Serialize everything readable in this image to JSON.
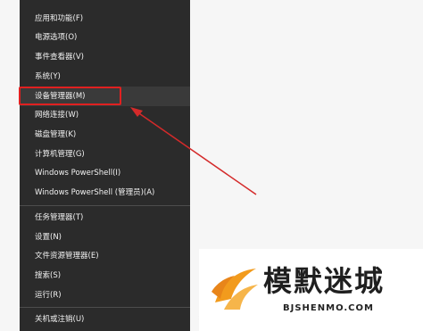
{
  "menu": {
    "items": [
      "应用和功能(F)",
      "电源选项(O)",
      "事件查看器(V)",
      "系统(Y)",
      "设备管理器(M)",
      "网络连接(W)",
      "磁盘管理(K)",
      "计算机管理(G)",
      "Windows PowerShell(I)",
      "Windows PowerShell (管理员)(A)",
      "任务管理器(T)",
      "设置(N)",
      "文件资源管理器(E)",
      "搜索(S)",
      "运行(R)",
      "关机或注销(U)"
    ],
    "selected_index": 4,
    "submenu_icon": "chevron-right-icon"
  },
  "annotation": {
    "highlight_color": "#e02020",
    "arrow_color": "#d42a2a"
  },
  "watermark": {
    "title": "模默迷城",
    "url": "BJSHENMO.COM"
  }
}
